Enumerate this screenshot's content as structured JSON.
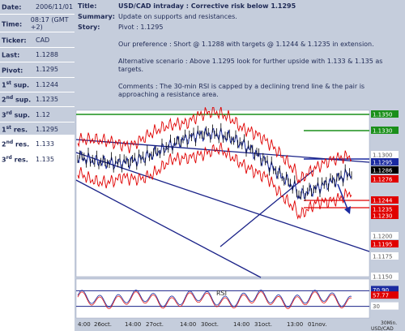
{
  "left_panel": [
    {
      "label": "Date:",
      "label_sup": "",
      "label_rest": "",
      "value": "2006/11/01"
    },
    {
      "label": "Time:",
      "label_sup": "",
      "label_rest": "",
      "value": "08:17 (GMT +2)"
    },
    {
      "label": "Ticker:",
      "label_sup": "",
      "label_rest": "",
      "value": "CAD"
    },
    {
      "label": "Last:",
      "label_sup": "",
      "label_rest": "",
      "value": "1.1288"
    },
    {
      "label": "Pivot:",
      "label_sup": "",
      "label_rest": "",
      "value": "1.1295"
    },
    {
      "label": "1",
      "label_sup": "st",
      "label_rest": " sup.",
      "value": "1.1244"
    },
    {
      "label": "2",
      "label_sup": "nd",
      "label_rest": " sup.",
      "value": "1.1235"
    },
    {
      "label": "3",
      "label_sup": "rd",
      "label_rest": " sup.",
      "value": "1.12"
    },
    {
      "label": "1",
      "label_sup": "st",
      "label_rest": " res.",
      "value": "1.1295"
    },
    {
      "label": "2",
      "label_sup": "nd",
      "label_rest": " res.",
      "value": "1.133"
    },
    {
      "label": "3",
      "label_sup": "rd",
      "label_rest": " res.",
      "value": "1.135"
    }
  ],
  "header": {
    "title_label": "Title:",
    "title": "USD/CAD intraday : Corrective risk below 1.1295",
    "summary_label": "Summary:",
    "summary": "Update on supports and resistances.",
    "story_label": "Story:",
    "story": [
      "Pivot : 1.1295",
      "Our preference : Short @ 1.1288 with targets @ 1.1244 & 1.1235 in extension.",
      "Alternative scenario : Above 1.1295 look for further upside with 1.133 & 1.135 as targets.",
      "Comments : The 30-min RSI is capped by a declining trend line & the pair is approaching a resistance area."
    ]
  },
  "chart": {
    "price_labels": [
      {
        "text": "1.1350",
        "bg": "#1a8f1a",
        "fg": "#fff"
      },
      {
        "text": "1.1330",
        "bg": "#1a8f1a",
        "fg": "#fff"
      },
      {
        "text": "1.1300",
        "bg": "#ffffff",
        "fg": "#555"
      },
      {
        "text": "1.1295",
        "bg": "#1a2aa0",
        "fg": "#fff"
      },
      {
        "text": "1.1286",
        "bg": "#000000",
        "fg": "#fff"
      },
      {
        "text": "1.1276",
        "bg": "#e00000",
        "fg": "#fff"
      },
      {
        "text": "1.1244",
        "bg": "#e00000",
        "fg": "#fff"
      },
      {
        "text": "1.1235",
        "bg": "#e00000",
        "fg": "#fff"
      },
      {
        "text": "1.1230",
        "bg": "#e00000",
        "fg": "#fff"
      },
      {
        "text": "1.1200",
        "bg": "#ffffff",
        "fg": "#555"
      },
      {
        "text": "1.1195",
        "bg": "#e00000",
        "fg": "#fff"
      },
      {
        "text": "1.1175",
        "bg": "#ffffff",
        "fg": "#555"
      },
      {
        "text": "1.1150",
        "bg": "#ffffff",
        "fg": "#555"
      }
    ],
    "rsi_label": "RSI",
    "rsi_values": [
      {
        "text": "70.90",
        "bg": "#1a2aa0",
        "fg": "#fff"
      },
      {
        "text": "57.77",
        "bg": "#e00000",
        "fg": "#fff"
      },
      {
        "text": "30",
        "bg": "#ffffff",
        "fg": "#555"
      }
    ],
    "x_ticks": [
      "4:00",
      "26oct.",
      "14:00",
      "27oct.",
      "14:00",
      "30oct.",
      "14:00",
      "31oct.",
      "13:00",
      "01nov."
    ],
    "corner_label": "30Min.",
    "corner_pair": "USD/CAD",
    "colors": {
      "bg": "#ffffff",
      "frame": "#c5cddc",
      "trend": "#1a2288",
      "band": "#e00000",
      "green": "#1a8f1a",
      "mavg": "#1a2aa0",
      "price": "#000000"
    }
  }
}
